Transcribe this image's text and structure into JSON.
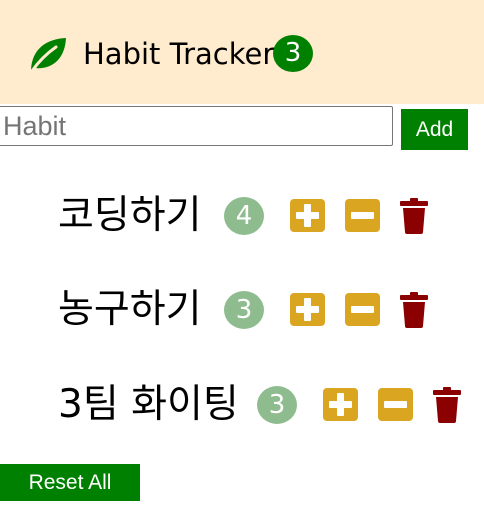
{
  "navbar": {
    "logo_icon": "leaf-icon",
    "title": "Habit Tracker",
    "total_count": "3",
    "background_color": "#ffebcd",
    "brand_color": "#008000"
  },
  "add_form": {
    "input_value": "",
    "input_placeholder": "Habit",
    "add_label": "Add"
  },
  "habits": [
    {
      "name": "코딩하기",
      "count": "4"
    },
    {
      "name": "농구하기",
      "count": "3"
    },
    {
      "name": "3팀 화이팅",
      "count": "3"
    }
  ],
  "habit_actions": {
    "increase_icon": "plus-square-icon",
    "decrease_icon": "minus-square-icon",
    "delete_icon": "trash-icon",
    "action_color": "#daa520",
    "delete_color": "#8b0000",
    "count_badge_color": "#8fbc8f"
  },
  "reset_label": "Reset All"
}
